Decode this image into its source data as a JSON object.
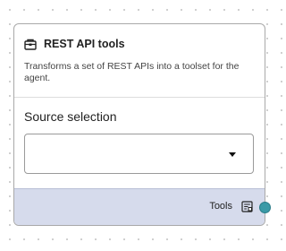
{
  "node": {
    "title": "REST API tools",
    "title_icon": "toolbox-icon",
    "description": "Transforms a set of REST APIs into a toolset for the agent."
  },
  "field": {
    "label": "Source selection",
    "selected_value": "",
    "control_icon": "dropdown-arrow-icon"
  },
  "footer": {
    "output_label": "Tools",
    "output_icon": "tools-output-icon"
  },
  "colors": {
    "footer_background": "#d6dbec",
    "handle": "#3b9aa7",
    "card_border": "#a9a9a9"
  }
}
